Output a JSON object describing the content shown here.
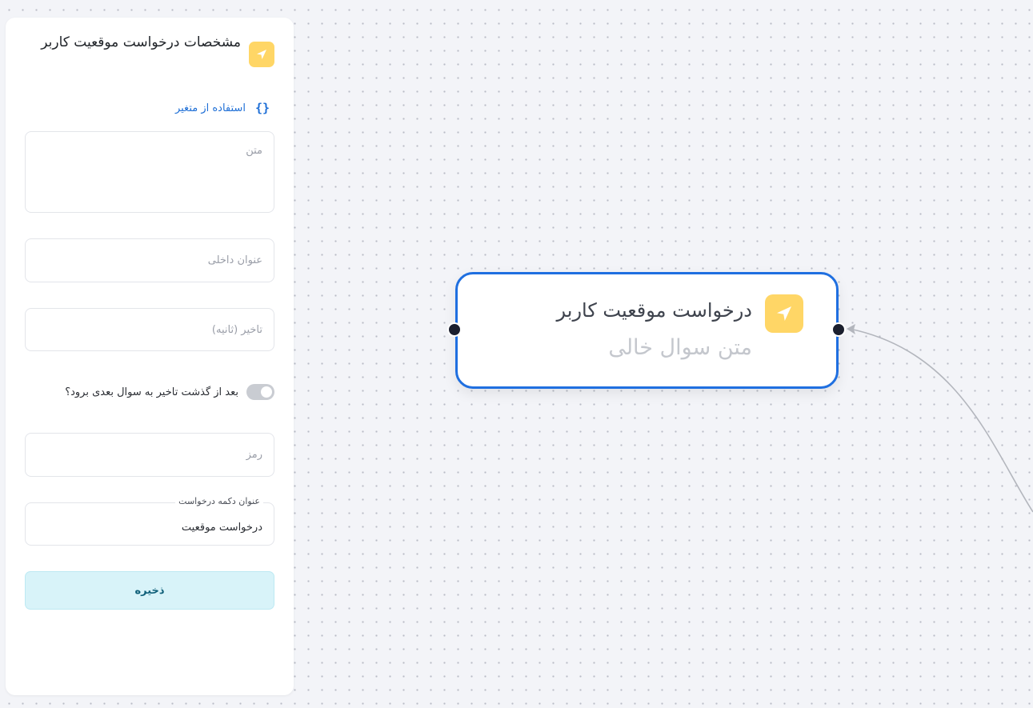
{
  "panel": {
    "title": "مشخصات درخواست موقعیت کاربر",
    "icon": "location-arrow-icon",
    "variable_link": "استفاده از متغیر",
    "text_placeholder": "متن",
    "internal_title_placeholder": "عنوان داخلی",
    "delay_placeholder": "تاخیر (ثانیه)",
    "toggle_label": "بعد از گذشت تاخیر به سوال بعدی برود؟",
    "password_placeholder": "رمز",
    "request_button_label": "عنوان دکمه درخواست",
    "request_button_value": "درخواست موقعیت",
    "save_label": "ذخیره"
  },
  "node": {
    "title": "درخواست موقعیت کاربر",
    "subtitle": "متن سوال خالی",
    "icon": "location-arrow-icon"
  },
  "colors": {
    "accent": "#1f6fe0",
    "badge": "#ffd666",
    "save_bg": "#d8f3f9"
  }
}
